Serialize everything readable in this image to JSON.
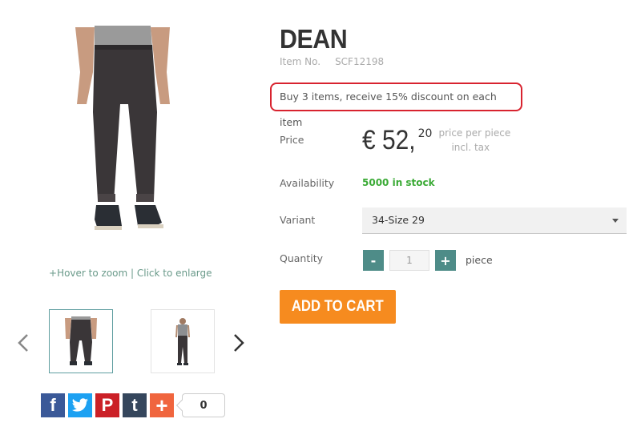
{
  "product": {
    "title": "DEAN",
    "item_no_label": "Item No.",
    "sku": "SCF12198",
    "promo": "Buy 3 items, receive 15% discount on each item"
  },
  "gallery": {
    "zoom_hint_plus": "+",
    "zoom_hint": "Hover to zoom | Click to enlarge",
    "thumbnails": [
      "pants-front",
      "model-full"
    ]
  },
  "price": {
    "label": "Price",
    "main": "€ 52,",
    "cents": "20",
    "per_piece": "price per piece",
    "incl_tax": "incl. tax"
  },
  "availability": {
    "label": "Availability",
    "value": "5000 in stock",
    "color": "#3aaa35"
  },
  "variant": {
    "label": "Variant",
    "selected": "34-Size 29"
  },
  "quantity": {
    "label": "Quantity",
    "minus": "-",
    "value": "1",
    "plus": "+",
    "unit": "piece"
  },
  "cart": {
    "button_label": "ADD TO CART",
    "color": "#f68b1f"
  },
  "share": {
    "facebook": "f",
    "twitter": "twitter-bird-icon",
    "pinterest": "P",
    "tumblr": "t",
    "more": "+",
    "count": "0"
  }
}
